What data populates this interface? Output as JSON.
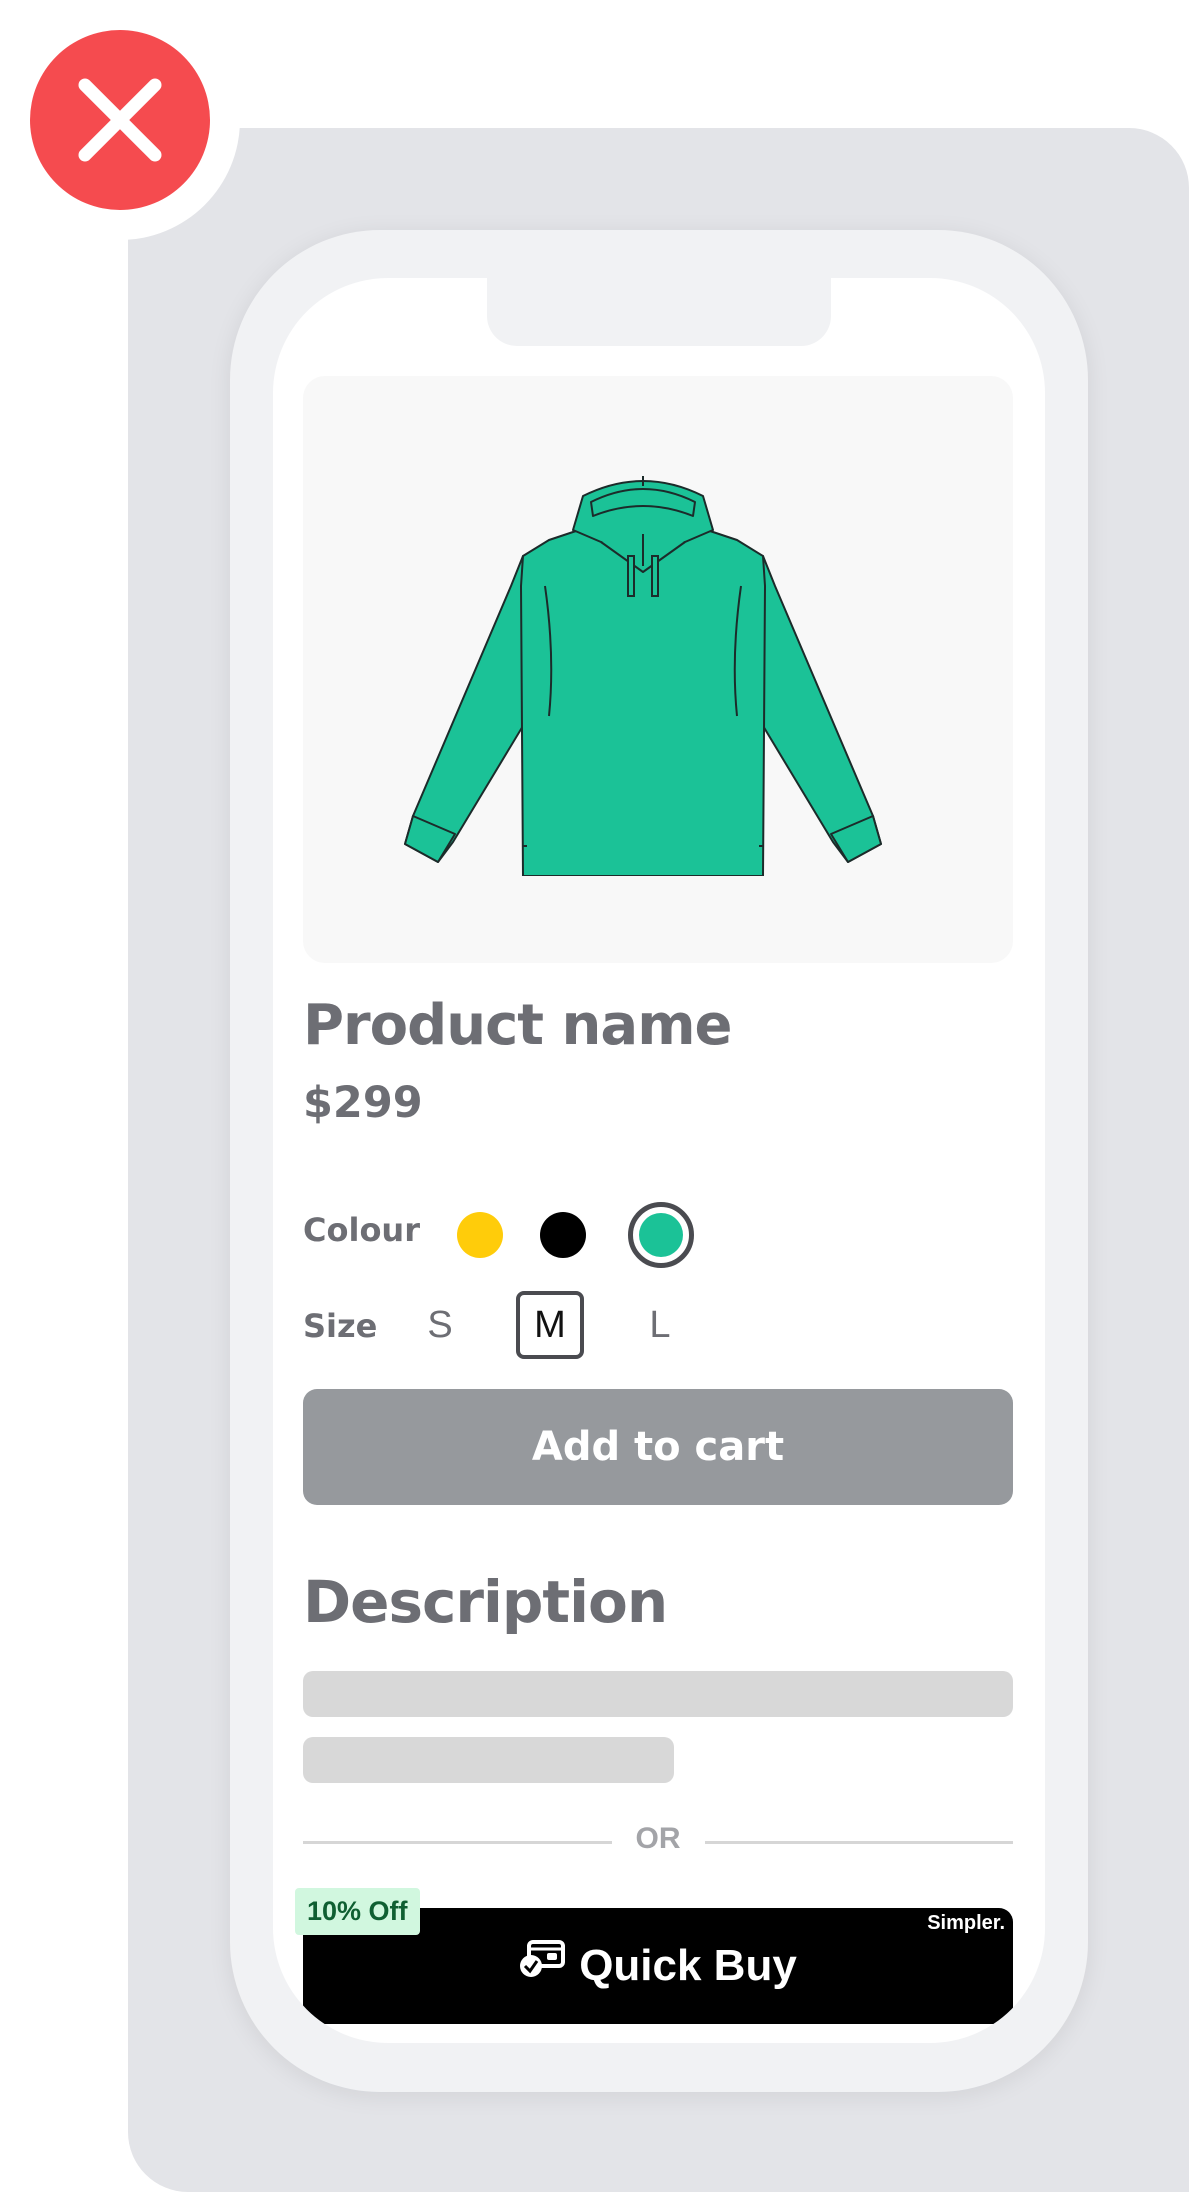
{
  "product": {
    "name": "Product name",
    "price": "$299",
    "image_icon": "hoodie-illustration",
    "hoodie_color": "#1bc297"
  },
  "colour": {
    "label": "Colour",
    "options": [
      {
        "name": "yellow",
        "hex": "#ffcc0a"
      },
      {
        "name": "black",
        "hex": "#000000"
      },
      {
        "name": "teal",
        "hex": "#1bc297",
        "selected": true
      }
    ]
  },
  "size": {
    "label": "Size",
    "options": [
      "S",
      "M",
      "L"
    ],
    "selected": "M"
  },
  "add_to_cart_label": "Add to cart",
  "description": {
    "heading": "Description"
  },
  "divider": {
    "label": "OR"
  },
  "quick_buy": {
    "label": "Quick Buy",
    "brand": "Simpler.",
    "discount": "10% Off",
    "icon": "wallet-check-icon"
  },
  "close_icon": "close-icon",
  "colors": {
    "close_red": "#f54b4f",
    "backdrop": "#e3e4e8",
    "button_gray": "#96999d",
    "text_gray": "#6d6e74",
    "discount_bg": "#d1f7df",
    "discount_text": "#0f5f32"
  }
}
